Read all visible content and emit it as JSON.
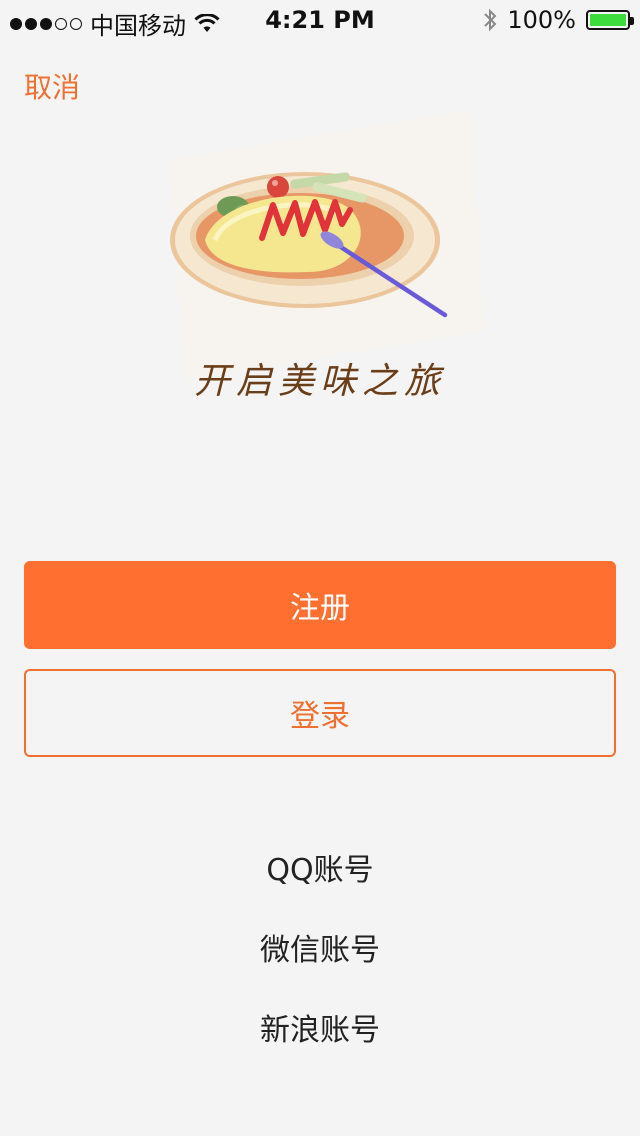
{
  "status_bar": {
    "carrier": "中国移动",
    "time": "4:21 PM",
    "battery": "100%",
    "signal_icon": "signal-dots-icon",
    "wifi_icon": "wifi-icon",
    "bluetooth_icon": "bluetooth-icon",
    "battery_icon": "battery-icon"
  },
  "header": {
    "cancel_label": "取消"
  },
  "hero": {
    "image": "omelette-rice-plate-illustration",
    "slogan": "开启美味之旅"
  },
  "actions": {
    "register_label": "注册",
    "login_label": "登录"
  },
  "social_login": {
    "qq_label": "QQ账号",
    "wechat_label": "微信账号",
    "weibo_label": "新浪账号"
  },
  "colors": {
    "accent": "#ff6f30",
    "accent_text": "#f07031",
    "background": "#f4f4f4"
  }
}
